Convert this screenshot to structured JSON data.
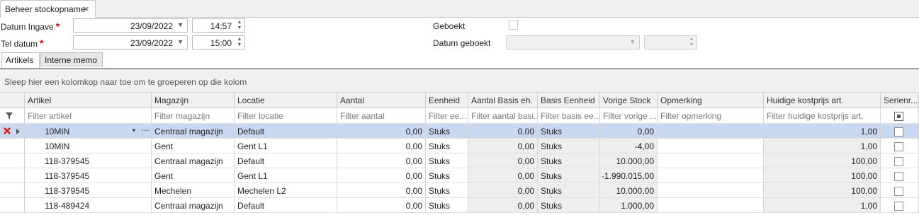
{
  "doc_tab": {
    "title": "Beheer stockopname",
    "close": "×"
  },
  "form": {
    "datum_ingave": {
      "label": "Datum Ingave",
      "required": "*",
      "date": "23/09/2022",
      "time": "14:57"
    },
    "tel_datum": {
      "label": "Tel datum",
      "required": "*",
      "date": "23/09/2022",
      "time": "15:00"
    },
    "geboekt": {
      "label": "Geboekt"
    },
    "datum_geboekt": {
      "label": "Datum geboekt",
      "date": "",
      "time": ""
    }
  },
  "tabs": [
    {
      "label": "Artikels",
      "active": true
    },
    {
      "label": "Interne memo",
      "active": false
    }
  ],
  "grid": {
    "group_hint": "Sleep hier een kolomkop naar toe om te groeperen op die kolom",
    "columns": [
      "Artikel",
      "Magazijn",
      "Locatie",
      "Aantal",
      "Eenheid",
      "Aantal Basis eh.",
      "Basis Eenheid",
      "Vorige Stock",
      "Opmerking",
      "Huidige kostprijs art.",
      "Serienr..."
    ],
    "filters": [
      "Filter artikel",
      "Filter magazijn",
      "Filter locatie",
      "Filter aantal",
      "Filter ee...",
      "Filter aantal basi...",
      "Filter basis ee...",
      "Filter vorige ...",
      "Filter opmerking",
      "Filter huidige kostprijs art.",
      ""
    ],
    "rows": [
      {
        "artikel": "10MIN",
        "magazijn": "Centraal magazijn",
        "locatie": "Default",
        "aantal": "0,00",
        "eenheid": "Stuks",
        "aantal_basis": "0,00",
        "basis_eenheid": "Stuks",
        "vorige_stock": "0,00",
        "opmerking": "",
        "kostprijs": "1,00"
      },
      {
        "artikel": "10MIN",
        "magazijn": "Gent",
        "locatie": "Gent L1",
        "aantal": "0,00",
        "eenheid": "Stuks",
        "aantal_basis": "0,00",
        "basis_eenheid": "Stuks",
        "vorige_stock": "-4,00",
        "opmerking": "",
        "kostprijs": "1,00"
      },
      {
        "artikel": "118-379545",
        "magazijn": "Centraal magazijn",
        "locatie": "Default",
        "aantal": "0,00",
        "eenheid": "Stuks",
        "aantal_basis": "0,00",
        "basis_eenheid": "Stuks",
        "vorige_stock": "10.000,00",
        "opmerking": "",
        "kostprijs": "100,00"
      },
      {
        "artikel": "118-379545",
        "magazijn": "Gent",
        "locatie": "Gent L1",
        "aantal": "0,00",
        "eenheid": "Stuks",
        "aantal_basis": "0,00",
        "basis_eenheid": "Stuks",
        "vorige_stock": "-1.990.015,00",
        "opmerking": "",
        "kostprijs": "100,00"
      },
      {
        "artikel": "118-379545",
        "magazijn": "Mechelen",
        "locatie": "Mechelen L2",
        "aantal": "0,00",
        "eenheid": "Stuks",
        "aantal_basis": "0,00",
        "basis_eenheid": "Stuks",
        "vorige_stock": "10.000,00",
        "opmerking": "",
        "kostprijs": "100,00"
      },
      {
        "artikel": "118-489424",
        "magazijn": "Centraal magazijn",
        "locatie": "Default",
        "aantal": "0,00",
        "eenheid": "Stuks",
        "aantal_basis": "0,00",
        "basis_eenheid": "Stuks",
        "vorige_stock": "1.000,00",
        "opmerking": "",
        "kostprijs": "1,00"
      }
    ]
  }
}
